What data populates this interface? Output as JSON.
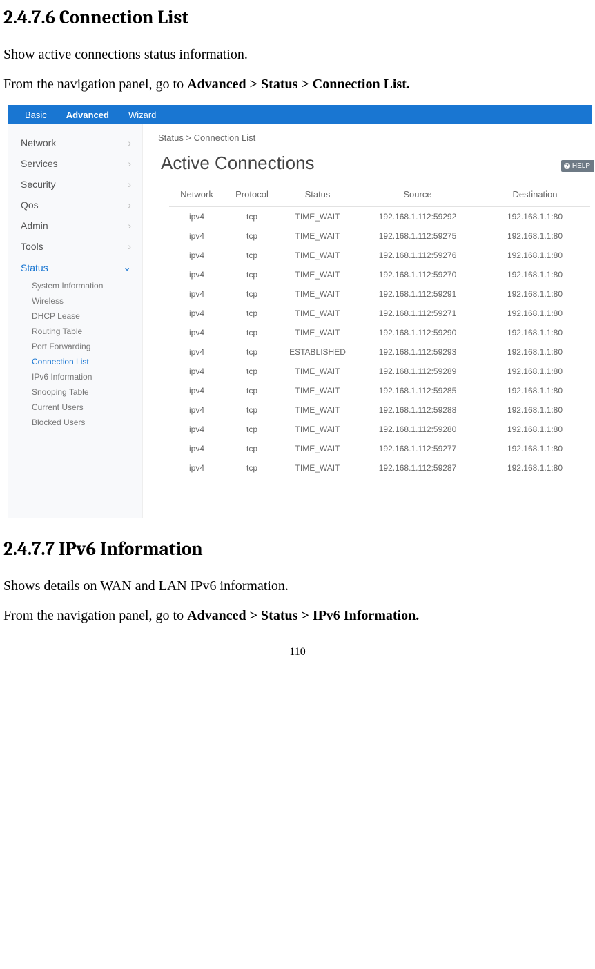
{
  "section1": {
    "heading": "2.4.7.6 Connection List",
    "p1": "Show active connections status information.",
    "p2_prefix": "From the navigation panel, go to ",
    "p2_bold": "Advanced > Status > Connection List."
  },
  "section2": {
    "heading": "2.4.7.7 IPv6 Information",
    "p1": "Shows details on WAN and LAN IPv6 information.",
    "p2_prefix": "From the navigation panel, go to ",
    "p2_bold": "Advanced > Status > IPv6 Information."
  },
  "page_number": "110",
  "ui": {
    "topbar": {
      "tabs": [
        "Basic",
        "Advanced",
        "Wizard"
      ],
      "active": "Advanced"
    },
    "sidebar": {
      "items": [
        {
          "label": "Network",
          "expanded": false
        },
        {
          "label": "Services",
          "expanded": false
        },
        {
          "label": "Security",
          "expanded": false
        },
        {
          "label": "Qos",
          "expanded": false
        },
        {
          "label": "Admin",
          "expanded": false
        },
        {
          "label": "Tools",
          "expanded": false
        },
        {
          "label": "Status",
          "expanded": true,
          "active": true
        }
      ],
      "subitems": [
        {
          "label": "System Information"
        },
        {
          "label": "Wireless"
        },
        {
          "label": "DHCP Lease"
        },
        {
          "label": "Routing Table"
        },
        {
          "label": "Port Forwarding"
        },
        {
          "label": "Connection List",
          "active": true
        },
        {
          "label": "IPv6 Information"
        },
        {
          "label": "Snooping Table"
        },
        {
          "label": "Current Users"
        },
        {
          "label": "Blocked Users"
        }
      ]
    },
    "breadcrumb": "Status > Connection List",
    "page_title": "Active Connections",
    "help_label": "HELP",
    "table": {
      "headers": [
        "Network",
        "Protocol",
        "Status",
        "Source",
        "Destination"
      ],
      "rows": [
        {
          "network": "ipv4",
          "protocol": "tcp",
          "status": "TIME_WAIT",
          "source": "192.168.1.112:59292",
          "destination": "192.168.1.1:80"
        },
        {
          "network": "ipv4",
          "protocol": "tcp",
          "status": "TIME_WAIT",
          "source": "192.168.1.112:59275",
          "destination": "192.168.1.1:80"
        },
        {
          "network": "ipv4",
          "protocol": "tcp",
          "status": "TIME_WAIT",
          "source": "192.168.1.112:59276",
          "destination": "192.168.1.1:80"
        },
        {
          "network": "ipv4",
          "protocol": "tcp",
          "status": "TIME_WAIT",
          "source": "192.168.1.112:59270",
          "destination": "192.168.1.1:80"
        },
        {
          "network": "ipv4",
          "protocol": "tcp",
          "status": "TIME_WAIT",
          "source": "192.168.1.112:59291",
          "destination": "192.168.1.1:80"
        },
        {
          "network": "ipv4",
          "protocol": "tcp",
          "status": "TIME_WAIT",
          "source": "192.168.1.112:59271",
          "destination": "192.168.1.1:80"
        },
        {
          "network": "ipv4",
          "protocol": "tcp",
          "status": "TIME_WAIT",
          "source": "192.168.1.112:59290",
          "destination": "192.168.1.1:80"
        },
        {
          "network": "ipv4",
          "protocol": "tcp",
          "status": "ESTABLISHED",
          "source": "192.168.1.112:59293",
          "destination": "192.168.1.1:80"
        },
        {
          "network": "ipv4",
          "protocol": "tcp",
          "status": "TIME_WAIT",
          "source": "192.168.1.112:59289",
          "destination": "192.168.1.1:80"
        },
        {
          "network": "ipv4",
          "protocol": "tcp",
          "status": "TIME_WAIT",
          "source": "192.168.1.112:59285",
          "destination": "192.168.1.1:80"
        },
        {
          "network": "ipv4",
          "protocol": "tcp",
          "status": "TIME_WAIT",
          "source": "192.168.1.112:59288",
          "destination": "192.168.1.1:80"
        },
        {
          "network": "ipv4",
          "protocol": "tcp",
          "status": "TIME_WAIT",
          "source": "192.168.1.112:59280",
          "destination": "192.168.1.1:80"
        },
        {
          "network": "ipv4",
          "protocol": "tcp",
          "status": "TIME_WAIT",
          "source": "192.168.1.112:59277",
          "destination": "192.168.1.1:80"
        },
        {
          "network": "ipv4",
          "protocol": "tcp",
          "status": "TIME_WAIT",
          "source": "192.168.1.112:59287",
          "destination": "192.168.1.1:80"
        }
      ]
    }
  }
}
